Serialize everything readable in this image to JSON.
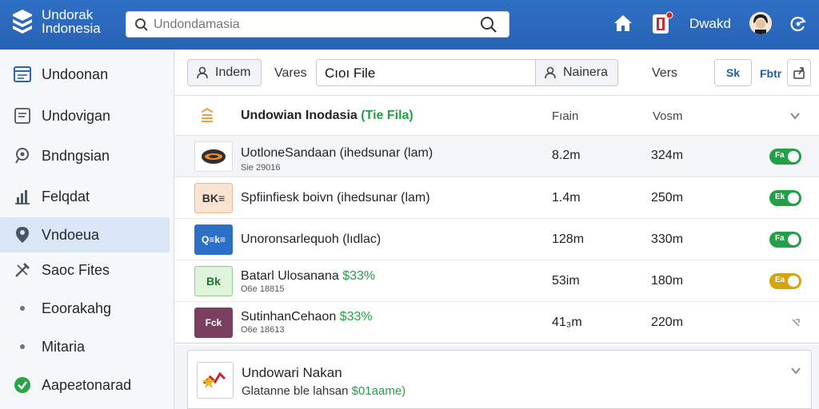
{
  "app": {
    "brand_line1": "Undorak",
    "brand_line2": "Indonesia",
    "user_name": "Dwakd"
  },
  "search": {
    "placeholder": "Undondamasia"
  },
  "sidebar": {
    "items": [
      {
        "label": "Undoonan",
        "icon": "window-icon"
      },
      {
        "label": "Undovigan",
        "icon": "document-icon"
      },
      {
        "label": "Bndngsian",
        "icon": "search-icon"
      },
      {
        "label": "Felqdat",
        "icon": "bar-chart-icon"
      },
      {
        "label": "Vndoeua",
        "icon": "location-pin-icon"
      },
      {
        "label": "Saoc Fites",
        "icon": "tools-icon"
      },
      {
        "label": "Eoorakahg",
        "icon": "bullet-icon"
      },
      {
        "label": "Mitaria",
        "icon": "bullet-icon"
      },
      {
        "label": "Aapeƨtonarad",
        "icon": "green-badge-icon"
      }
    ]
  },
  "toolbar": {
    "btn1": "Indem",
    "label_vers": "Vares",
    "file_value": "Cıoı File",
    "btn_nainera": "Nainera",
    "label_vers2": "Vers",
    "btn_sk": "Sk",
    "btn_fbtr": "Fbtr"
  },
  "table": {
    "header": {
      "title": "Undowian Inodasia",
      "title_tag": "(Tie Fila)",
      "col_size": "Fıain",
      "col_vers": "Vosm"
    },
    "rows": [
      {
        "thumb": "",
        "name": "UotloneSandaan",
        "tag": "(ihedsunar (lam)",
        "sub": "Sie 29016",
        "size": "8.2m",
        "vers": "324m",
        "toggle_label": "Fa",
        "toggle_color": "#22a045"
      },
      {
        "thumb": "BK≡",
        "name": "Spfiinfiesk boivn",
        "tag": "(ihedsunar (lam)",
        "sub": "",
        "size": "1.4m",
        "vers": "250m",
        "toggle_label": "Ek",
        "toggle_color": "#22a045"
      },
      {
        "thumb": "Q≡k≡",
        "name": "Unoronsarlequoh",
        "tag": "(lıdlac)",
        "sub": "",
        "size": "128m",
        "vers": "330m",
        "toggle_label": "Fa",
        "toggle_color": "#22a045"
      },
      {
        "thumb": "Bk",
        "name": "Batarl Ulosanana",
        "tag": "$33%",
        "sub": "O6e 18815",
        "size": "53im",
        "vers": "180m",
        "toggle_label": "Ea",
        "toggle_color": "#d4a40f"
      },
      {
        "thumb": "Fck",
        "name": "SutinhanCehaon",
        "tag": "$33%",
        "sub": "O6e 18613",
        "size": "41₃m",
        "vers": "220m",
        "toggle_label": "",
        "toggle_color": ""
      }
    ]
  },
  "card": {
    "title": "Undowari Nakan",
    "sub_prefix": "Glatanne ble lahsan",
    "sub_tag": "$01aame)"
  },
  "colors": {
    "header_blue": "#2a68bb",
    "active_nav": "#d9e6f6",
    "accent_green": "#22a045",
    "accent_yellow": "#d4a40f"
  }
}
